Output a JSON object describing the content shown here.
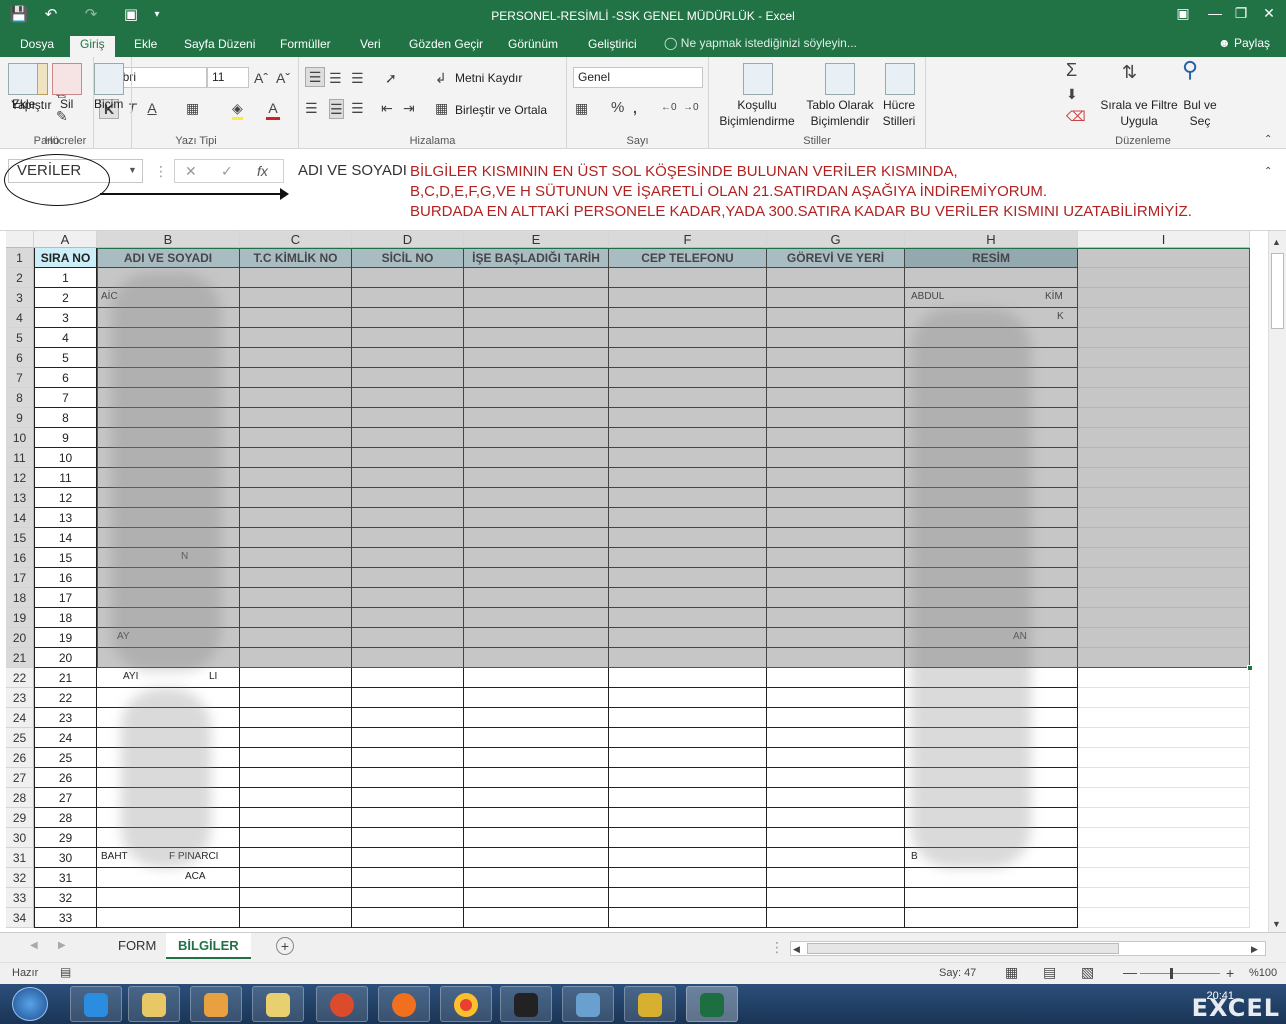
{
  "window": {
    "title": "PERSONEL-RESİMLİ -SSK GENEL MÜDÜRLÜK - Excel"
  },
  "tabs": [
    "Dosya",
    "Giriş",
    "Ekle",
    "Sayfa Düzeni",
    "Formüller",
    "Veri",
    "Gözden Geçir",
    "Görünüm",
    "Geliştirici"
  ],
  "tell_me": "Ne yapmak istediğinizi söyleyin...",
  "share": "Paylaş",
  "ribbon": {
    "pano": {
      "label": "Pano",
      "paste": "Yapıştır"
    },
    "font": {
      "label": "Yazı Tipi",
      "family": "Calibri",
      "size": "11",
      "bold": "K",
      "italic": "T",
      "underline": "A",
      "color": "A"
    },
    "align": {
      "label": "Hizalama",
      "wrap": "Metni Kaydır",
      "merge": "Birleştir ve Ortala"
    },
    "number": {
      "label": "Sayı",
      "format": "Genel",
      "percent": "%",
      "comma": ","
    },
    "styles": {
      "label": "Stiller",
      "cond": "Koşullu Biçimlendirme",
      "table": "Tablo Olarak Biçimlendir",
      "cell": "Hücre Stilleri"
    },
    "cells": {
      "label": "Hücreler",
      "insert": "Ekle",
      "delete": "Sil",
      "format": "Biçim"
    },
    "edit": {
      "label": "Düzenleme",
      "sort": "Sırala ve Filtre Uygula",
      "find": "Bul ve Seç"
    }
  },
  "formula_bar": {
    "name_box": "VERİLER",
    "value": "ADI VE SOYADI",
    "annotation": [
      "BİLGİLER KISMININ EN ÜST SOL KÖŞESİNDE BULUNAN VERİLER KISMINDA,",
      "B,C,D,E,F,G,VE H SÜTUNUN VE İŞARETLİ OLAN 21.SATIRDAN AŞAĞIYA İNDİREMİYORUM.",
      "BURDADA EN ALTTAKİ PERSONELE KADAR,YADA 300.SATIRA KADAR BU VERİLER KISMINI UZATABİLİRMİYİZ."
    ]
  },
  "columns": [
    "A",
    "B",
    "C",
    "D",
    "E",
    "F",
    "G",
    "H",
    "I"
  ],
  "header_row": [
    "SIRA NO",
    "ADI VE SOYADI",
    "T.C KİMLİK NO",
    "SİCİL NO",
    "İŞE BAŞLADIĞI TARİH",
    "CEP TELEFONU",
    "GÖREVİ VE YERİ",
    "RESİM"
  ],
  "row_numbers": [
    "1",
    "2",
    "3",
    "4",
    "5",
    "6",
    "7",
    "8",
    "9",
    "10",
    "11",
    "12",
    "13",
    "14",
    "15",
    "16",
    "17",
    "18",
    "19",
    "20",
    "21",
    "22",
    "23",
    "24",
    "25",
    "26",
    "27",
    "28",
    "29",
    "30",
    "31",
    "32",
    "33",
    "34"
  ],
  "sira_no": [
    "1",
    "2",
    "3",
    "4",
    "5",
    "6",
    "7",
    "8",
    "9",
    "10",
    "11",
    "12",
    "13",
    "14",
    "15",
    "16",
    "17",
    "18",
    "19",
    "20",
    "21",
    "22",
    "23",
    "24",
    "25",
    "26",
    "27",
    "28",
    "29",
    "30",
    "31",
    "32",
    "33"
  ],
  "visible_text": {
    "b3": "AİC",
    "b16": "N",
    "b20": "AY",
    "b22": "AYI",
    "b22r": "LI",
    "b31": "BAHT",
    "b31r": "F PINARCI",
    "b32": "ACA",
    "h3": "ABDUL",
    "h3r": "KİM",
    "h4r": "K",
    "h20r": "AN",
    "h31": "B"
  },
  "sheets": [
    "FORM",
    "BİLGİLER"
  ],
  "status": {
    "mode": "Hazır",
    "count": "Say: 47",
    "zoom": "%100"
  },
  "clock": "20:41",
  "brand": "EXCEL"
}
